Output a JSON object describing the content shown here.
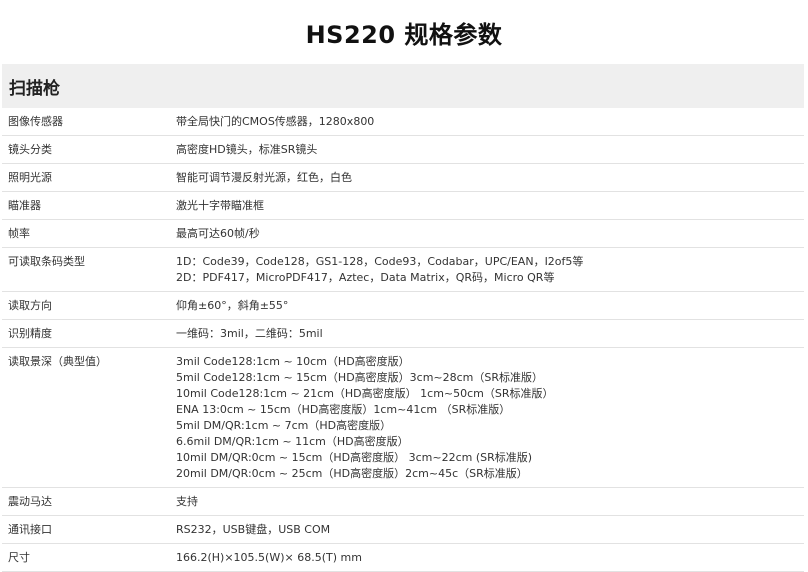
{
  "title": "HS220 规格参数",
  "section": "扫描枪",
  "rows": [
    {
      "label": "图像传感器",
      "values": [
        "带全局快门的CMOS传感器，1280x800"
      ]
    },
    {
      "label": "镜头分类",
      "values": [
        "高密度HD镜头，标准SR镜头"
      ]
    },
    {
      "label": "照明光源",
      "values": [
        "智能可调节漫反射光源，红色，白色"
      ]
    },
    {
      "label": "瞄准器",
      "values": [
        "激光十字带瞄准框"
      ]
    },
    {
      "label": "帧率",
      "values": [
        "最高可达60帧/秒"
      ]
    },
    {
      "label": "可读取条码类型",
      "values": [
        "1D：Code39，Code128，GS1-128，Code93，Codabar，UPC/EAN，I2of5等",
        "2D：PDF417，MicroPDF417，Aztec，Data Matrix，QR码，Micro QR等"
      ]
    },
    {
      "label": "读取方向",
      "values": [
        "仰角±60°，斜角±55°"
      ]
    },
    {
      "label": "识别精度",
      "values": [
        "一维码：3mil，二维码：5mil"
      ]
    },
    {
      "label": "读取景深（典型值）",
      "values": [
        "3mil Code128:1cm ~ 10cm（HD高密度版）",
        "5mil Code128:1cm ~ 15cm（HD高密度版）3cm~28cm（SR标准版）",
        "10mil Code128:1cm ~ 21cm（HD高密度版） 1cm~50cm（SR标准版）",
        "ENA 13:0cm ~ 15cm（HD高密度版）1cm~41cm （SR标准版）",
        "5mil DM/QR:1cm ~ 7cm（HD高密度版）",
        "6.6mil DM/QR:1cm ~ 11cm（HD高密度版）",
        "10mil DM/QR:0cm ~ 15cm（HD高密度版） 3cm~22cm (SR标准版)",
        "20mil DM/QR:0cm ~ 25cm（HD高密度版）2cm~45c（SR标准版）"
      ]
    },
    {
      "label": "震动马达",
      "values": [
        "支持"
      ]
    },
    {
      "label": "通讯接口",
      "values": [
        "RS232，USB键盘，USB COM"
      ]
    },
    {
      "label": "尺寸",
      "values": [
        "166.2(H)×105.5(W)× 68.5(T) mm"
      ]
    }
  ]
}
